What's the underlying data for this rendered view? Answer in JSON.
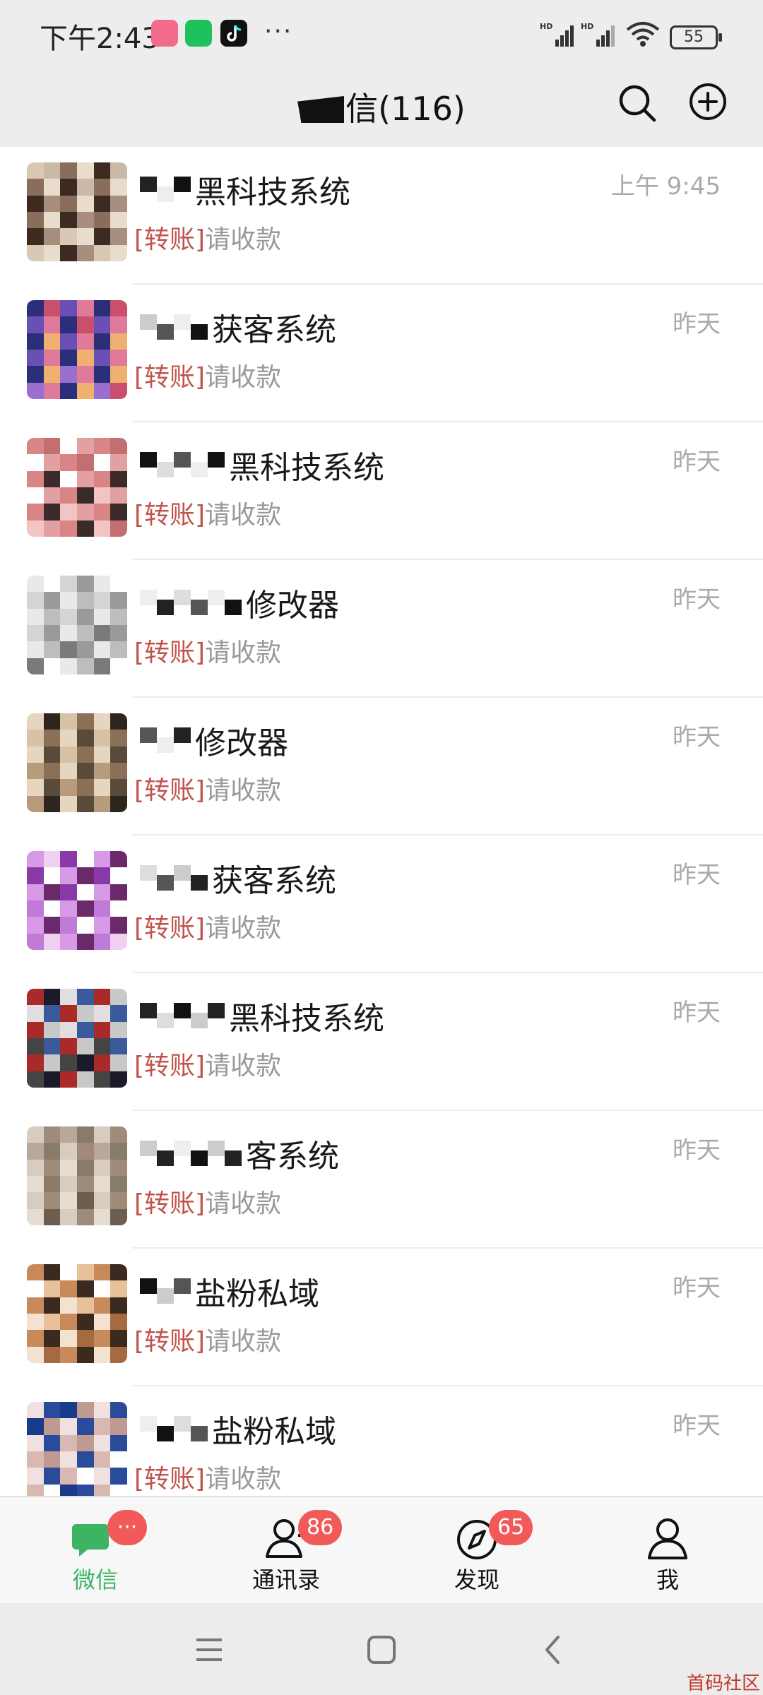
{
  "status_bar": {
    "time": "下午2:43",
    "battery": "55",
    "network": "HD"
  },
  "header": {
    "title": "信(116)"
  },
  "chats": [
    {
      "name": "黑科技系统",
      "tag": "[转账]",
      "preview": "请收款",
      "time": "上午 9:45"
    },
    {
      "name": "获客系统",
      "tag": "[转账]",
      "preview": "请收款",
      "time": "昨天"
    },
    {
      "name": "黑科技系统",
      "tag": "[转账]",
      "preview": "请收款",
      "time": "昨天"
    },
    {
      "name": "修改器",
      "tag": "[转账]",
      "preview": "请收款",
      "time": "昨天"
    },
    {
      "name": "修改器",
      "tag": "[转账]",
      "preview": "请收款",
      "time": "昨天"
    },
    {
      "name": "获客系统",
      "tag": "[转账]",
      "preview": "请收款",
      "time": "昨天"
    },
    {
      "name": "黑科技系统",
      "tag": "[转账]",
      "preview": "请收款",
      "time": "昨天"
    },
    {
      "name": "客系统",
      "tag": "[转账]",
      "preview": "请收款",
      "time": "昨天"
    },
    {
      "name": "盐粉私域",
      "tag": "[转账]",
      "preview": "请收款",
      "time": "昨天"
    },
    {
      "name": "盐粉私域",
      "tag": "[转账]",
      "preview": "请收款",
      "time": "昨天"
    }
  ],
  "tabs": [
    {
      "label": "微信",
      "badge": "···",
      "icon": "chat-bubble-icon"
    },
    {
      "label": "通讯录",
      "badge": "86",
      "icon": "contacts-icon"
    },
    {
      "label": "发现",
      "badge": "65",
      "icon": "compass-icon"
    },
    {
      "label": "我",
      "badge": "",
      "icon": "person-icon"
    }
  ],
  "watermark": "首码社区",
  "colors": {
    "accent_green": "#3cb462",
    "badge_red": "#f25a5a",
    "transfer_tag": "#c0544c"
  }
}
